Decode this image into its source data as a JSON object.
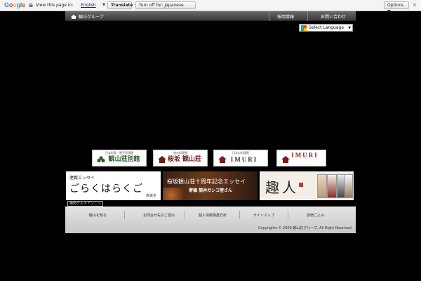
{
  "translate_bar": {
    "logo": "Google",
    "prompt": "View this page in:",
    "language": "English",
    "translate_label": "Translate",
    "turn_off_label": "Turn off for: Japanese",
    "options_label": "Options ▼",
    "close": "×"
  },
  "header": {
    "home": "観山グループ",
    "recruit": "採用情報",
    "contact": "お問い合わせ"
  },
  "language_select": {
    "value": "Select Language"
  },
  "brands": [
    {
      "sub": "日本料理・割烹居酒屋",
      "name": "観山荘別館"
    },
    {
      "sub": "旅の料理屋",
      "name": "桜坂 観山荘"
    },
    {
      "sub": "日本の料理屋",
      "name": "IMURI"
    },
    {
      "sub": "",
      "name": "IMURI"
    }
  ],
  "banners": {
    "essay": {
      "kicker": "連載エッセイ",
      "title": "ごらくはらくご",
      "author": "高坂圭"
    },
    "anniversary": {
      "title": "桜坂観山荘十周年記念エッセイ",
      "byline": "寄稿 筒井ガンコ堂さん"
    },
    "shumi": {
      "title": "趣人"
    }
  },
  "tag_link": "焼肉グルメアンニュ",
  "footer": {
    "nav": [
      "観山を知る",
      "お問合せ先のご案内",
      "個人情報保護方針",
      "サイトマップ",
      "旅宿ごよみ"
    ],
    "copyright": "Copyrights © 2009 観山荘グループ, All Right Reserved"
  }
}
